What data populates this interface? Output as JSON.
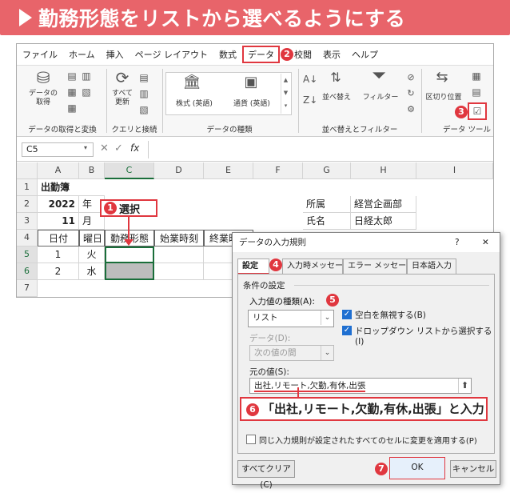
{
  "banner": {
    "title": "勤務形態をリストから選べるようにする"
  },
  "menu": [
    "ファイル",
    "ホーム",
    "挿入",
    "ページ レイアウト",
    "数式",
    "データ",
    "校閲",
    "表示",
    "ヘルプ"
  ],
  "ribbon": {
    "get_data": "データの\n取得",
    "refresh_all": "すべて\n更新",
    "stocks": "株式 (英語)",
    "currency": "通貨 (英語)",
    "sort": "並べ替え",
    "filter": "フィルター",
    "text_to_columns": "区切り位置",
    "groups": [
      "データの取得と変換",
      "クエリと接続",
      "データの種類",
      "並べ替えとフィルター",
      "データ ツール"
    ]
  },
  "formula": {
    "namebox": "C5",
    "fx": "fx"
  },
  "columns": [
    "A",
    "B",
    "C",
    "D",
    "E",
    "F",
    "G",
    "H",
    "I"
  ],
  "rows": [
    "1",
    "2",
    "3",
    "4",
    "5",
    "6",
    "7"
  ],
  "cells": {
    "a1": "出勤簿",
    "a2": "2022",
    "b2": "年",
    "a3": "11",
    "b3": "月",
    "g2": "所属",
    "h2": "経営企画部",
    "g3": "氏名",
    "h3": "日経太郎",
    "a4": "日付",
    "b4": "曜日",
    "c4": "勤務形態",
    "d4": "始業時刻",
    "e4": "終業時刻",
    "a5": "1",
    "b5": "火",
    "a6": "2",
    "b6": "水"
  },
  "steps": {
    "s1": "1",
    "s1_label": "選択",
    "s2": "2",
    "s3": "3",
    "s4": "4",
    "s5": "5",
    "s6": "6",
    "s7": "7"
  },
  "dialog": {
    "title": "データの入力規則",
    "help": "?",
    "close": "✕",
    "tabs": [
      "設定",
      "入力時メッセージ",
      "エラー メッセージ",
      "日本語入力"
    ],
    "section": "条件の設定",
    "allow_label": "入力値の種類(A):",
    "allow_value": "リスト",
    "ignore_blank": "空白を無視する(B)",
    "dropdown": "ドロップダウン リストから選択する(I)",
    "data_label": "データ(D):",
    "data_value": "次の値の間",
    "source_label": "元の値(S):",
    "source_value": "出社,リモート,欠勤,有休,出張",
    "apply_all": "同じ入力規則が設定されたすべてのセルに変更を適用する(P)",
    "clear_all": "すべてクリア(C)",
    "ok": "OK",
    "cancel": "キャンセル"
  },
  "callout": {
    "text": "「出社,リモート,欠勤,有休,出張」と入力"
  },
  "colors": {
    "accent": "#e0373f",
    "banner": "#e8646a",
    "excel_green": "#1a6e3a"
  }
}
